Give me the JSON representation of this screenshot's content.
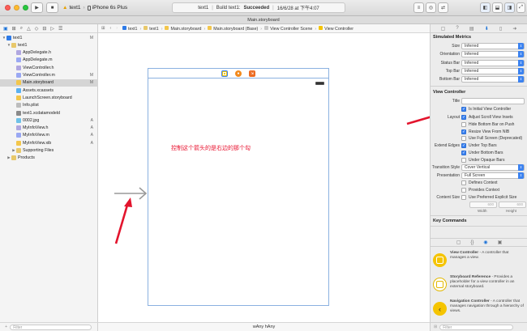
{
  "toolbar": {
    "run_icon": "play-icon",
    "stop_icon": "stop-icon",
    "scheme": "text1",
    "device": "iPhone 6s Plus",
    "activity_project": "text1",
    "activity_status_prefix": "Build text1:",
    "activity_status": "Succeeded",
    "activity_time": "16/6/28 at 下午4:07"
  },
  "tab": {
    "title": "Main.storyboard"
  },
  "navigator": {
    "rows": [
      {
        "label": "text1",
        "status": "M",
        "indent": 0,
        "kind": "project"
      },
      {
        "label": "text1",
        "status": "",
        "indent": 1,
        "kind": "folder"
      },
      {
        "label": "AppDelegate.h",
        "status": "",
        "indent": 2,
        "kind": "h"
      },
      {
        "label": "AppDelegate.m",
        "status": "",
        "indent": 2,
        "kind": "m"
      },
      {
        "label": "ViewController.h",
        "status": "",
        "indent": 2,
        "kind": "h"
      },
      {
        "label": "ViewController.m",
        "status": "M",
        "indent": 2,
        "kind": "m"
      },
      {
        "label": "Main.storyboard",
        "status": "M",
        "indent": 2,
        "kind": "sb",
        "selected": true
      },
      {
        "label": "Assets.xcassets",
        "status": "",
        "indent": 2,
        "kind": "assets"
      },
      {
        "label": "LaunchScreen.storyboard",
        "status": "",
        "indent": 2,
        "kind": "sb"
      },
      {
        "label": "Info.plist",
        "status": "",
        "indent": 2,
        "kind": "plist"
      },
      {
        "label": "text1.xcdatamodeld",
        "status": "",
        "indent": 2,
        "kind": "model"
      },
      {
        "label": "0002.jpg",
        "status": "A",
        "indent": 2,
        "kind": "img"
      },
      {
        "label": "MyInfoView.h",
        "status": "A",
        "indent": 2,
        "kind": "h"
      },
      {
        "label": "MyInfoView.m",
        "status": "A",
        "indent": 2,
        "kind": "m"
      },
      {
        "label": "MyInfoView.xib",
        "status": "A",
        "indent": 2,
        "kind": "xib"
      },
      {
        "label": "Supporting Files",
        "status": "",
        "indent": 2,
        "kind": "folder"
      },
      {
        "label": "Products",
        "status": "",
        "indent": 1,
        "kind": "folder"
      }
    ],
    "filter_placeholder": "Filter"
  },
  "jumpbar": [
    "text1",
    "text1",
    "Main.storyboard",
    "Main.storyboard (Base)",
    "View Controller Scene",
    "View Controller"
  ],
  "canvas": {
    "annotation": "控制这个箭头的是右边的那个勾",
    "size_class": "wAny hAny"
  },
  "inspector": {
    "simulated_metrics_title": "Simulated Metrics",
    "metrics": [
      {
        "label": "Size",
        "value": "Inferred"
      },
      {
        "label": "Orientation",
        "value": "Inferred"
      },
      {
        "label": "Status Bar",
        "value": "Inferred"
      },
      {
        "label": "Top Bar",
        "value": "Inferred"
      },
      {
        "label": "Bottom Bar",
        "value": "Inferred"
      }
    ],
    "vc_title": "View Controller",
    "title_label": "Title",
    "title_value": "",
    "is_initial": "Is Initial View Controller",
    "layout_label": "Layout",
    "layout_checks": [
      {
        "label": "Adjust Scroll View Insets",
        "checked": true
      },
      {
        "label": "Hide Bottom Bar on Push",
        "checked": false
      },
      {
        "label": "Resize View From NIB",
        "checked": true
      },
      {
        "label": "Use Full Screen (Deprecated)",
        "checked": false
      }
    ],
    "edges_label": "Extend Edges",
    "edges_checks": [
      {
        "label": "Under Top Bars",
        "checked": true
      },
      {
        "label": "Under Bottom Bars",
        "checked": true
      },
      {
        "label": "Under Opaque Bars",
        "checked": false
      }
    ],
    "transition_label": "Transition Style",
    "transition_value": "Cover Vertical",
    "presentation_label": "Presentation",
    "presentation_value": "Full Screen",
    "context_checks": [
      {
        "label": "Defines Context",
        "checked": false
      },
      {
        "label": "Provides Context",
        "checked": false
      }
    ],
    "content_size_label": "Content Size",
    "content_size_check": "Use Preferred Explicit Size",
    "width_value": "600",
    "height_value": "600",
    "width_label": "Width",
    "height_label": "Height",
    "key_commands": "Key Commands",
    "library": [
      {
        "name": "View Controller",
        "desc": " - A controller that manages a view.",
        "icon": "view-controller-icon"
      },
      {
        "name": "Storyboard Reference",
        "desc": " - Provides a placeholder for a view controller in an external storyboard.",
        "icon": "storyboard-reference-icon"
      },
      {
        "name": "Navigation Controller",
        "desc": " - A controller that manages navigation through a hierarchy of views.",
        "icon": "navigation-controller-icon"
      }
    ],
    "filter_placeholder": "Filter"
  },
  "colors": {
    "accent": "#3b82f0",
    "annotation": "#e8102d",
    "scene_border": "#8bb1e0",
    "vc_icon": "#f5c400"
  }
}
